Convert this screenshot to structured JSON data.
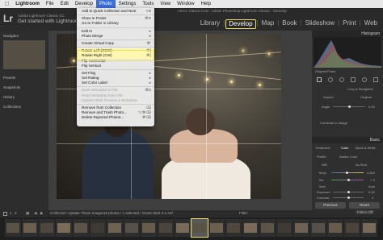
{
  "menubar": {
    "app": "Lightroom",
    "items": [
      "File",
      "Edit",
      "Develop",
      "Photo",
      "Settings",
      "Tools",
      "View",
      "Window",
      "Help"
    ],
    "active_index": 3
  },
  "window": {
    "title": "LRCC Classic.lrcat - Adobe Photoshop Lightroom Classic - Develop"
  },
  "identity": {
    "logo": "Lr",
    "small": "Adobe Lightroom Classic CC",
    "big": "Get started with Lightroom mobile"
  },
  "modules": {
    "items": [
      "Library",
      "Develop",
      "Map",
      "Book",
      "Slideshow",
      "Print",
      "Web"
    ],
    "active_index": 1,
    "separator": "|"
  },
  "photo_menu": {
    "rows": [
      {
        "label": "Add to Quick Collection and Next",
        "shortcut": "⇧B",
        "disabled": false
      },
      {
        "divider": true
      },
      {
        "label": "Show in Finder",
        "shortcut": "⌘R",
        "disabled": false
      },
      {
        "label": "Go to Folder in Library",
        "shortcut": "",
        "disabled": false
      },
      {
        "divider": true
      },
      {
        "label": "Edit In",
        "arrow": "▸",
        "disabled": false
      },
      {
        "label": "Photo Merge",
        "arrow": "▸",
        "disabled": false
      },
      {
        "divider": true
      },
      {
        "label": "Create Virtual Copy",
        "shortcut": "⌘'",
        "disabled": false
      },
      {
        "divider": true
      },
      {
        "label": "Rotate Left (CCW)",
        "shortcut": "⌘[",
        "disabled": false,
        "highlight": true
      },
      {
        "label": "Rotate Right (CW)",
        "shortcut": "⌘]",
        "disabled": false,
        "highlight": true
      },
      {
        "label": "Flip Horizontal",
        "shortcut": "",
        "disabled": false
      },
      {
        "label": "Flip Vertical",
        "shortcut": "",
        "disabled": false
      },
      {
        "divider": true
      },
      {
        "label": "Set Flag",
        "arrow": "▸",
        "disabled": false
      },
      {
        "label": "Set Rating",
        "arrow": "▸",
        "disabled": false
      },
      {
        "label": "Set Color Label",
        "arrow": "▸",
        "disabled": false
      },
      {
        "divider": true
      },
      {
        "label": "Save Metadata to File",
        "shortcut": "⌘S",
        "disabled": true
      },
      {
        "label": "Read Metadata from File",
        "shortcut": "",
        "disabled": true
      },
      {
        "label": "Update DNG Preview & Metadata",
        "shortcut": "",
        "disabled": true
      },
      {
        "divider": true
      },
      {
        "label": "Remove from Collection",
        "shortcut": "⌫",
        "disabled": false
      },
      {
        "label": "Remove and Trash Photo...",
        "shortcut": "⌥⌘⌫",
        "disabled": false
      },
      {
        "label": "Delete Rejected Photos...",
        "shortcut": "⌘⌫",
        "disabled": false
      }
    ]
  },
  "left_panel": {
    "navigator": "Navigator",
    "presets": "Presets",
    "snapshots": "Snapshots",
    "history": "History",
    "collections": "Collections"
  },
  "right_panel": {
    "histogram": "Histogram",
    "original_photo": "Original Photo",
    "crop_label": "Crop & Straighten",
    "aspect_label": "Aspect:",
    "aspect_value": "Original",
    "angle_label": "Angle",
    "angle_value": "0.00",
    "constrain_label": "Constrain to Image",
    "basic": "Basic",
    "treatment_label": "Treatment:",
    "treatment_color": "Color",
    "treatment_bw": "Black & White",
    "profile_label": "Profile:",
    "profile_value": "Adobe Color",
    "wb_label": "WB:",
    "wb_value": "As Shot",
    "temp_label": "Temp",
    "temp_value": "4,800",
    "tint_label": "Tint",
    "tint_value": "+ 3",
    "tone_label": "Tone",
    "tone_auto": "Auto",
    "exposure_label": "Exposure",
    "exposure_value": "0.00",
    "contrast_label": "Contrast",
    "contrast_value": "0",
    "previous_button": "Previous",
    "reset_button": "Reset"
  },
  "filmstrip": {
    "page1": "1",
    "page2": "2",
    "collection_text": "Collection: Update These Images",
    "count_text": "18 photos / 1 selected / Smart Start 3-1.nef",
    "filter_label": "Filter:",
    "filter_value": "Filters Off",
    "thumb_count": 22,
    "selected_index": 11
  },
  "colors": {
    "highlight_box": "#e6e060",
    "menu_active": "#3c6ed9"
  }
}
